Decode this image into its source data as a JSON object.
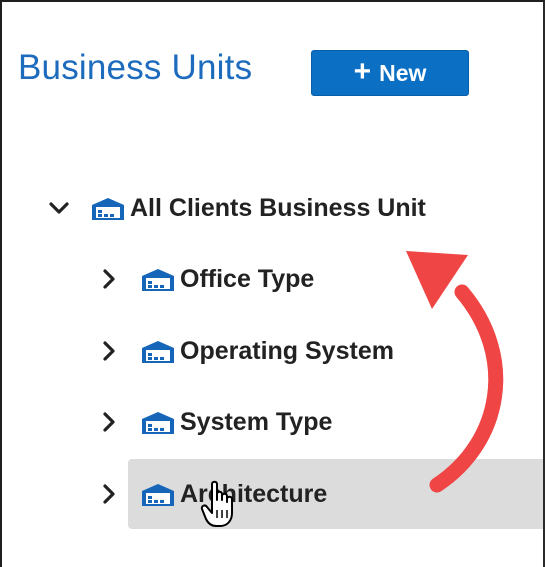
{
  "header": {
    "title": "Business Units",
    "new_button_label": "New",
    "new_button_icon": "plus-icon"
  },
  "tree": {
    "root": {
      "label": "All Clients Business Unit",
      "expanded": true,
      "icon": "building-icon"
    },
    "children": [
      {
        "label": "Office Type",
        "expanded": false,
        "icon": "building-icon"
      },
      {
        "label": "Operating System",
        "expanded": false,
        "icon": "building-icon"
      },
      {
        "label": "System Type",
        "expanded": false,
        "icon": "building-icon"
      },
      {
        "label": "Architecture",
        "expanded": false,
        "icon": "building-icon",
        "hovered": true
      }
    ]
  },
  "colors": {
    "title": "#1d6bbd",
    "button_bg": "#0b6fc4",
    "icon": "#1565b8",
    "hover_bg": "#dcdcdc",
    "annotation_arrow": "#f04545"
  },
  "annotation": {
    "type": "curved-arrow",
    "icon": "red-curved-arrow-icon"
  },
  "pointer": {
    "icon": "hand-pointer-icon"
  }
}
